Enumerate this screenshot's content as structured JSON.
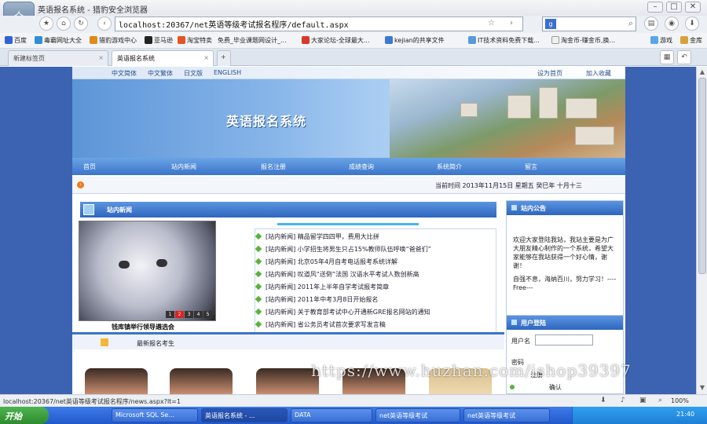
{
  "browser": {
    "title": "英语报名系统 - 猎豹安全浏览器",
    "url": "localhost:20367/net英语等级考试报名程序/default.aspx",
    "status": "localhost:20367/net英语等级考试报名程序/news.aspx?lt=1",
    "zoom": "100%",
    "logo_text": "✧"
  },
  "favorites": [
    "百度",
    "毒霸网址大全",
    "猎豹游戏中心",
    "亚马逊",
    "淘宝特卖",
    "免费_毕业课题网设计_...",
    "大家论坛-全球最大...",
    "kejian的共享文件",
    "IT技术资料免费下载...",
    "淘金币-赚金币,换...",
    "游戏",
    "金库"
  ],
  "tabs": [
    {
      "label": "新建标签页"
    },
    {
      "label": "英语报名系统"
    }
  ],
  "site": {
    "top_links": [
      "中文简体",
      "中文繁体",
      "日文版",
      "ENGLISH"
    ],
    "top_right": [
      "设为首页",
      "加入收藏"
    ],
    "banner_title": "英语报名系统",
    "menu": [
      "首页",
      "站内新闻",
      "报名注册",
      "成绩查询",
      "系统简介",
      "留言"
    ],
    "date_text": "当前时间  2013年11月15日  星期五  癸巳年  十月十三",
    "news_section": "站内新闻",
    "photo_caption": "钱库镇举行领导遴选会",
    "pager": [
      "1",
      "2",
      "3",
      "4",
      "5"
    ],
    "news": [
      "[站内新闻] 精品留学四四甲，费用大比拼",
      "[站内新闻] 小学招生将男生只占15%教师队伍呼唤“爸爸们”",
      "[站内新闻] 北京05年4月自考电话报考系统详解",
      "[站内新闻] 叹道风“送倒”法国 汉语水平考试人数创新高",
      "[站内新闻] 2011年上半年自学考试报考简章",
      "[站内新闻] 2011年中考3月8日开始报名",
      "[站内新闻] 关于教育部考试中心开通新GRE报名网站的通知",
      "[站内新闻] 省公务员考试首次要求写发言稿"
    ],
    "latest_label": "最新报名考生",
    "notice_title": "站内公告",
    "notice_text": "欢迎大家登陆我站，我站主要是为广大朋友精心制作的一个系统，希望大家能够在我站获得一个好心情，谢谢！",
    "notice_text2": "自强不息，海纳百川，努力学习！----Free---",
    "login_title": "用户登陆",
    "login_label": "用户名",
    "login_links": [
      "密码",
      "注册",
      "确认"
    ]
  },
  "watermark": "https://www.huzhan.com/ishop39397",
  "taskbar": {
    "start": "开始",
    "tasks": [
      "Microsoft SQL Se...",
      "英语报名系统 - ...",
      "DATA",
      "net英语等级考试",
      "net英语等级考试"
    ],
    "clock": "21:40"
  }
}
